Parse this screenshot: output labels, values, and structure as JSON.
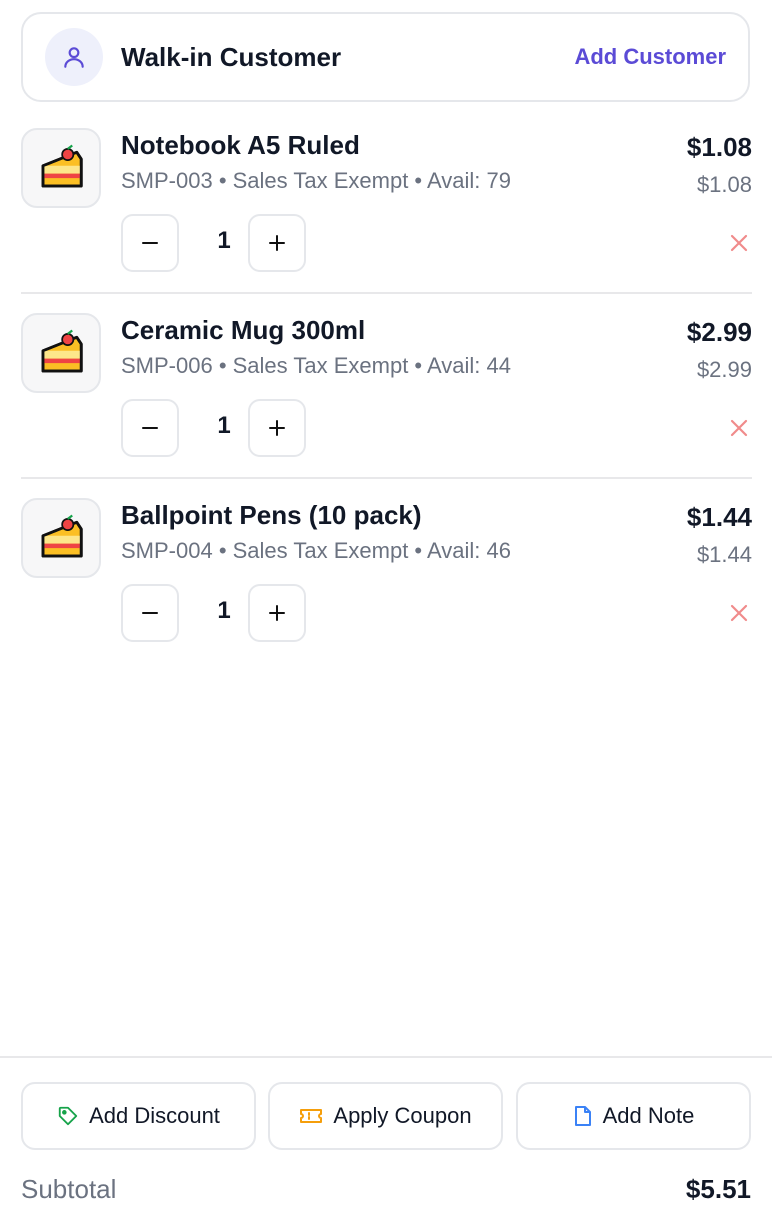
{
  "customer": {
    "name": "Walk-in Customer",
    "add_label": "Add Customer",
    "accent_color": "#5b4bd6"
  },
  "cart": {
    "items": [
      {
        "name": "Notebook A5 Ruled",
        "meta": "SMP-003 • Sales Tax Exempt • Avail: 79",
        "price": "$1.08",
        "unit_price": "$1.08",
        "qty": "1",
        "icon": "cake-slice-icon"
      },
      {
        "name": "Ceramic Mug 300ml",
        "meta": "SMP-006 • Sales Tax Exempt • Avail: 44",
        "price": "$2.99",
        "unit_price": "$2.99",
        "qty": "1",
        "icon": "cake-slice-icon"
      },
      {
        "name": "Ballpoint Pens (10 pack)",
        "meta": "SMP-004 • Sales Tax Exempt • Avail: 46",
        "price": "$1.44",
        "unit_price": "$1.44",
        "qty": "1",
        "icon": "cake-slice-icon"
      }
    ]
  },
  "actions": {
    "discount_label": "Add Discount",
    "coupon_label": "Apply Coupon",
    "note_label": "Add Note",
    "discount_color": "#16a34a",
    "coupon_color": "#f59e0b",
    "note_color": "#3b82f6"
  },
  "totals": {
    "subtotal_label": "Subtotal",
    "subtotal_value": "$5.51"
  },
  "remove_color": "#f08b8b"
}
